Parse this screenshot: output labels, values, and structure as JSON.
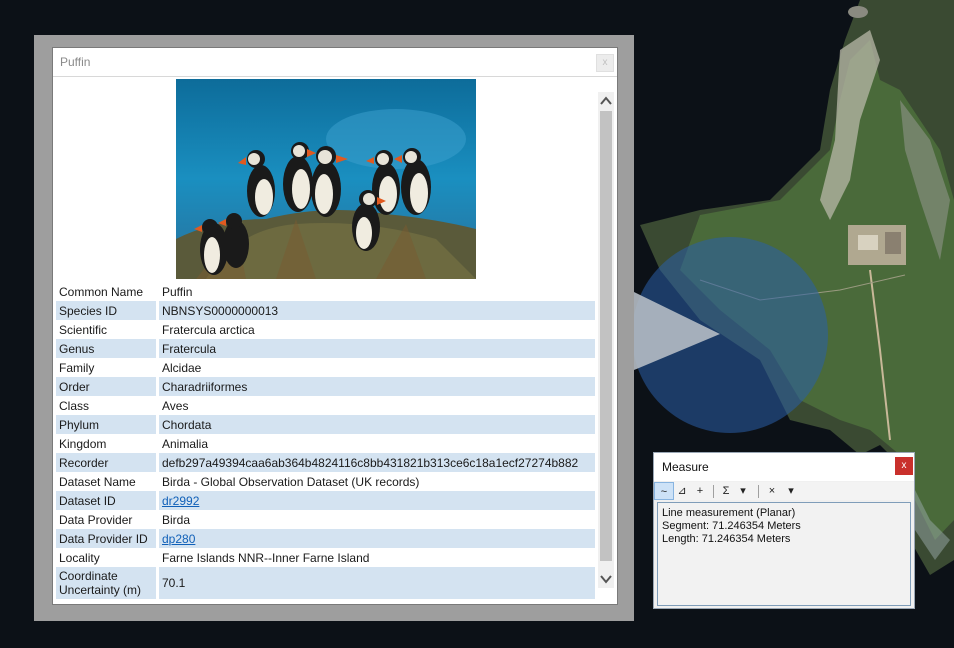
{
  "popup": {
    "title": "Puffin",
    "close_label": "x",
    "photo_icon": "puffin-photo",
    "rows": [
      {
        "key": "Common Name",
        "value": "Puffin"
      },
      {
        "key": "Species ID",
        "value": "NBNSYS0000000013"
      },
      {
        "key": "Scientific",
        "value": "Fratercula arctica"
      },
      {
        "key": "Genus",
        "value": "Fratercula"
      },
      {
        "key": "Family",
        "value": "Alcidae"
      },
      {
        "key": "Order",
        "value": "Charadriiformes"
      },
      {
        "key": "Class",
        "value": "Aves"
      },
      {
        "key": "Phylum",
        "value": "Chordata"
      },
      {
        "key": "Kingdom",
        "value": "Animalia"
      },
      {
        "key": "Recorder",
        "value": "defb297a49394caa6ab364b4824116c8bb431821b313ce6c18a1ecf27274b882"
      },
      {
        "key": "Dataset Name",
        "value": "Birda - Global Observation Dataset (UK records)"
      },
      {
        "key": "Dataset ID",
        "value": "dr2992"
      },
      {
        "key": "Data Provider",
        "value": "Birda"
      },
      {
        "key": "Data Provider ID",
        "value": "dp280"
      },
      {
        "key": "Locality",
        "value": "Farne Islands NNR--Inner Farne Island"
      },
      {
        "key": "Coordinate Uncertainty (m)",
        "value": "70.1"
      }
    ]
  },
  "measure": {
    "title": "Measure",
    "close_label": "x",
    "toolbar": {
      "line_tool": "~",
      "area_tool": "⊿",
      "point_tool": "+",
      "sum_tool": "Σ",
      "dropdown": "▾",
      "clear_tool": "×"
    },
    "output": {
      "line1": "Line measurement (Planar)",
      "line2": "Segment: 71.246354 Meters",
      "line3": "Length: 71.246354 Meters"
    }
  },
  "colors": {
    "row_alt": "#d4e3f1",
    "link": "#1060b8",
    "close_red": "#c9302c"
  }
}
